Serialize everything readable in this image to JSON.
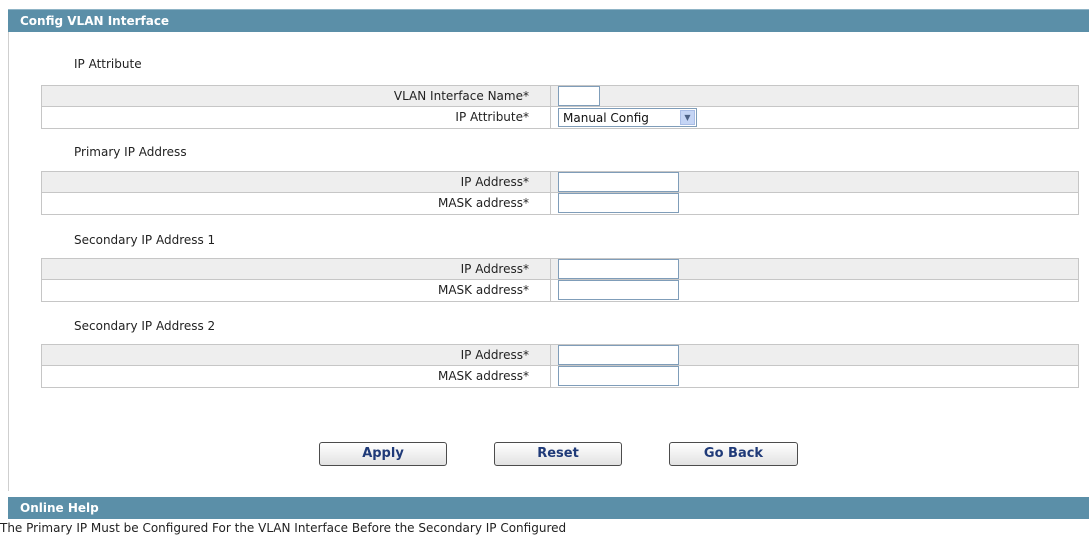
{
  "panel": {
    "title": "Config VLAN Interface"
  },
  "sections": {
    "ip_attribute": {
      "heading": "IP Attribute",
      "vlan_name_label": "VLAN Interface Name*",
      "vlan_name_value": "",
      "ip_attr_label": "IP Attribute*",
      "ip_attr_selected": "Manual Config"
    },
    "primary": {
      "heading": "Primary IP Address",
      "ip_label": "IP Address*",
      "ip_value": "",
      "mask_label": "MASK address*",
      "mask_value": ""
    },
    "secondary1": {
      "heading": "Secondary IP Address 1",
      "ip_label": "IP Address*",
      "ip_value": "",
      "mask_label": "MASK address*",
      "mask_value": ""
    },
    "secondary2": {
      "heading": "Secondary IP Address 2",
      "ip_label": "IP Address*",
      "ip_value": "",
      "mask_label": "MASK address*",
      "mask_value": ""
    }
  },
  "buttons": {
    "apply": "Apply",
    "reset": "Reset",
    "back": "Go Back"
  },
  "help": {
    "title": "Online Help",
    "text": "The Primary IP Must be Configured For the VLAN Interface Before the Secondary IP Configured"
  },
  "icons": {
    "select_arrow": "chevron-down-icon"
  },
  "colors": {
    "header_bg": "#5b8fa8",
    "row_shade": "#eeeeee",
    "button_text": "#1f3a78"
  }
}
